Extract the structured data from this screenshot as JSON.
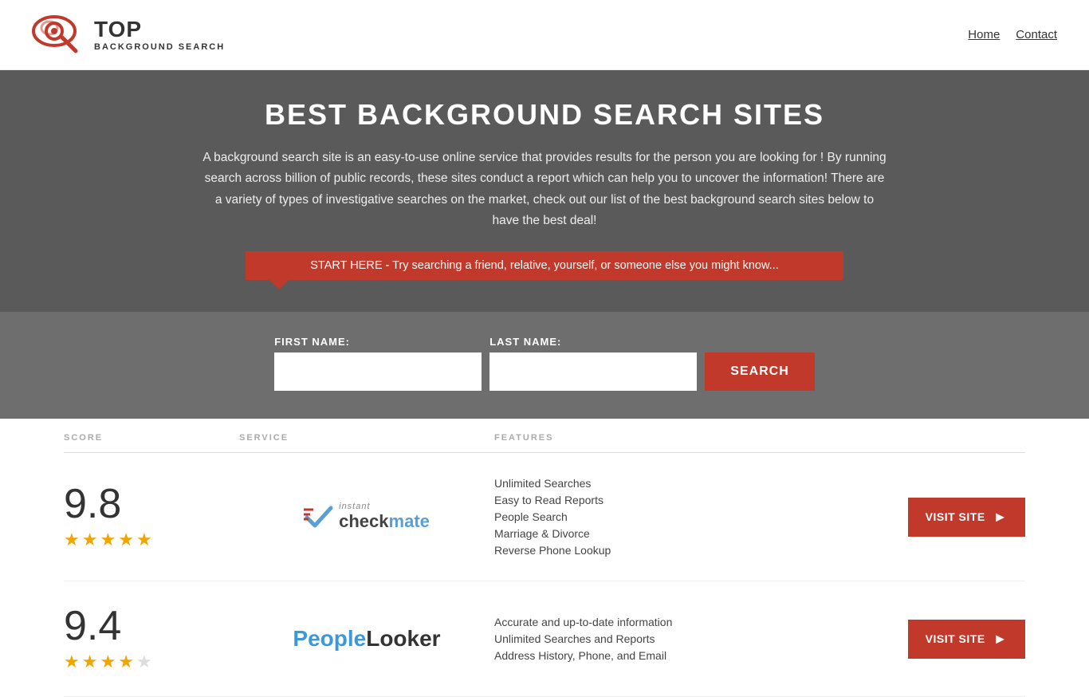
{
  "header": {
    "logo_top": "TOP",
    "logo_bottom": "BACKGROUND SEARCH",
    "nav": {
      "home": "Home",
      "contact": "Contact"
    }
  },
  "hero": {
    "title": "BEST BACKGROUND SEARCH SITES",
    "description": "A background search site is an easy-to-use online service that provides results  for the person you are looking for ! By  running  search across billion of public records, these sites conduct  a report which can help you to uncover the information! There are a variety of types of investigative searches on the market, check out our  list of the best background search sites below to have the best deal!",
    "search_banner": "START HERE - Try searching a friend, relative, yourself, or someone else you might know..."
  },
  "search_form": {
    "first_name_label": "FIRST NAME:",
    "last_name_label": "LAST NAME:",
    "button_label": "SEARCH"
  },
  "columns": {
    "score": "SCORE",
    "service": "SERVICE",
    "features": "FEATURES"
  },
  "results": [
    {
      "score": "9.8",
      "stars": 5,
      "service_name": "Instant Checkmate",
      "features": [
        "Unlimited Searches",
        "Easy to Read Reports",
        "People Search",
        "Marriage & Divorce",
        "Reverse Phone Lookup"
      ],
      "visit_label": "VISIT SITE"
    },
    {
      "score": "9.4",
      "stars": 4,
      "service_name": "PeopleLooker",
      "features": [
        "Accurate and up-to-date information",
        "Unlimited Searches and Reports",
        "Address History, Phone, and Email"
      ],
      "visit_label": "VISIT SITE"
    }
  ]
}
